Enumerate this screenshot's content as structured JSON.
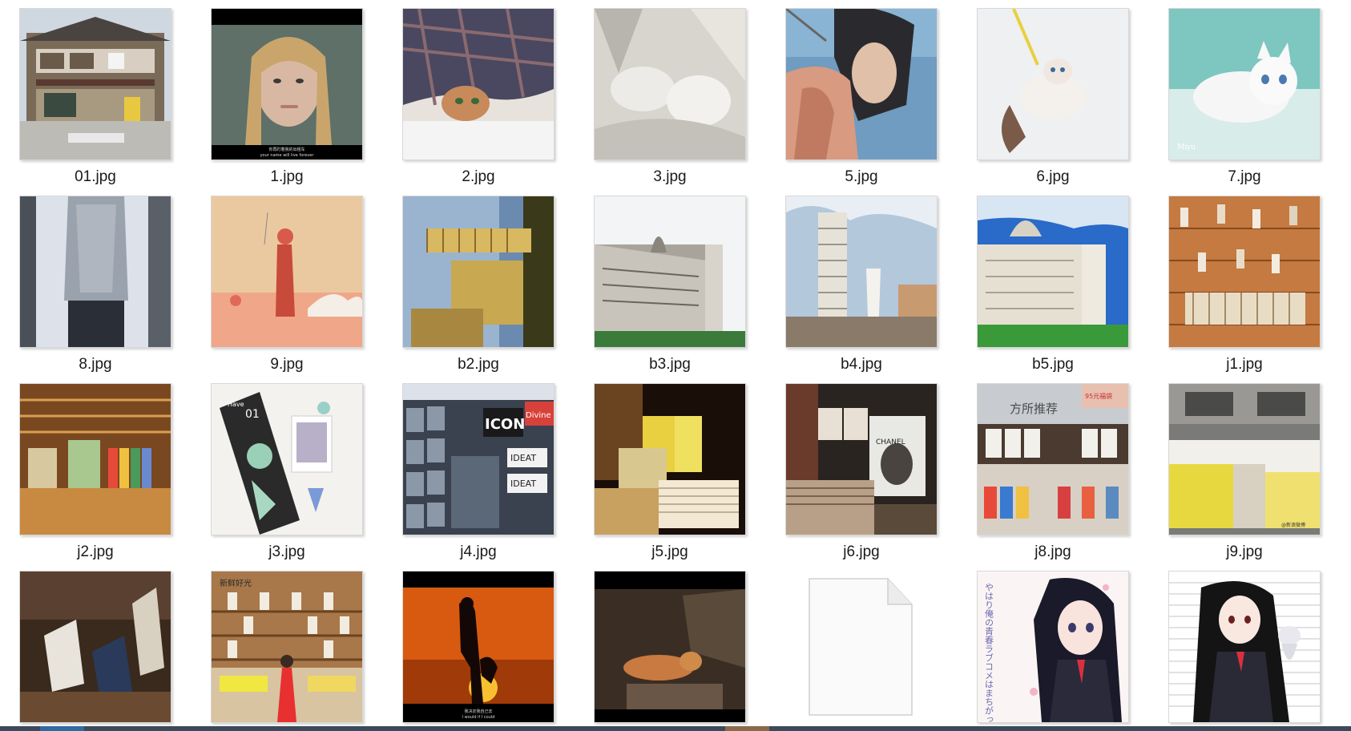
{
  "window": {
    "title": ""
  },
  "files": [
    {
      "name": "01.jpg",
      "thumb": "thumb-house"
    },
    {
      "name": "1.jpg",
      "thumb": "thumb-girl-portrait"
    },
    {
      "name": "2.jpg",
      "thumb": "thumb-kitten-blanket"
    },
    {
      "name": "3.jpg",
      "thumb": "thumb-white-cat-sleeping"
    },
    {
      "name": "5.jpg",
      "thumb": "thumb-anime-archer"
    },
    {
      "name": "6.jpg",
      "thumb": "thumb-kitten-white-bg"
    },
    {
      "name": "7.jpg",
      "thumb": "thumb-white-kitten-teal"
    },
    {
      "name": "8.jpg",
      "thumb": "thumb-girl-window"
    },
    {
      "name": "9.jpg",
      "thumb": "thumb-illustration-girl"
    },
    {
      "name": "b2.jpg",
      "thumb": "thumb-pisa-rotated"
    },
    {
      "name": "b3.jpg",
      "thumb": "thumb-pisa-cathedral"
    },
    {
      "name": "b4.jpg",
      "thumb": "thumb-pisa-tower"
    },
    {
      "name": "b5.jpg",
      "thumb": "thumb-pisa-blue-sky"
    },
    {
      "name": "j1.jpg",
      "thumb": "thumb-bookshelf-wall"
    },
    {
      "name": "j2.jpg",
      "thumb": "thumb-book-display"
    },
    {
      "name": "j3.jpg",
      "thumb": "thumb-notebook"
    },
    {
      "name": "j4.jpg",
      "thumb": "thumb-magazine-rack"
    },
    {
      "name": "j5.jpg",
      "thumb": "thumb-bookstore-warm"
    },
    {
      "name": "j6.jpg",
      "thumb": "thumb-bookstore-chanel"
    },
    {
      "name": "j8.jpg",
      "thumb": "thumb-bookstore-recommend"
    },
    {
      "name": "j9.jpg",
      "thumb": "thumb-bookstore-tables"
    },
    {
      "name": "",
      "thumb": "thumb-books-stand"
    },
    {
      "name": "",
      "thumb": "thumb-girl-red-dress"
    },
    {
      "name": "",
      "thumb": "thumb-sunset-silhouette"
    },
    {
      "name": "",
      "thumb": "thumb-cat-sleeping-dark"
    },
    {
      "name": "",
      "thumb": "blank-file-icon"
    },
    {
      "name": "",
      "thumb": "thumb-anime-girl-pink"
    },
    {
      "name": "",
      "thumb": "thumb-anime-girl-cat"
    }
  ],
  "overlay_text": {
    "f1_sub1": "你再盯着我的出租车",
    "f1_sub2": "your name will live forever",
    "f7_sig": "Miyu",
    "f16_num": "01",
    "f16_word": "Have",
    "f17_icon": "ICON",
    "f17_ideat": "IDEAT",
    "f17_ideat2": "IDEAT",
    "f17_divine": "Divine",
    "f19_chanel": "CHANEL",
    "f20_banner": "方所推荐",
    "f20_red": "95元福袋",
    "f21_mark": "@新浪微博",
    "f23_sign": "新鲜好光",
    "f24_sub": "我决定我自己去",
    "f24_sub2": "I would if I could",
    "f27_jp": "やはり俺の青春ラブコメはまちがっている。"
  }
}
